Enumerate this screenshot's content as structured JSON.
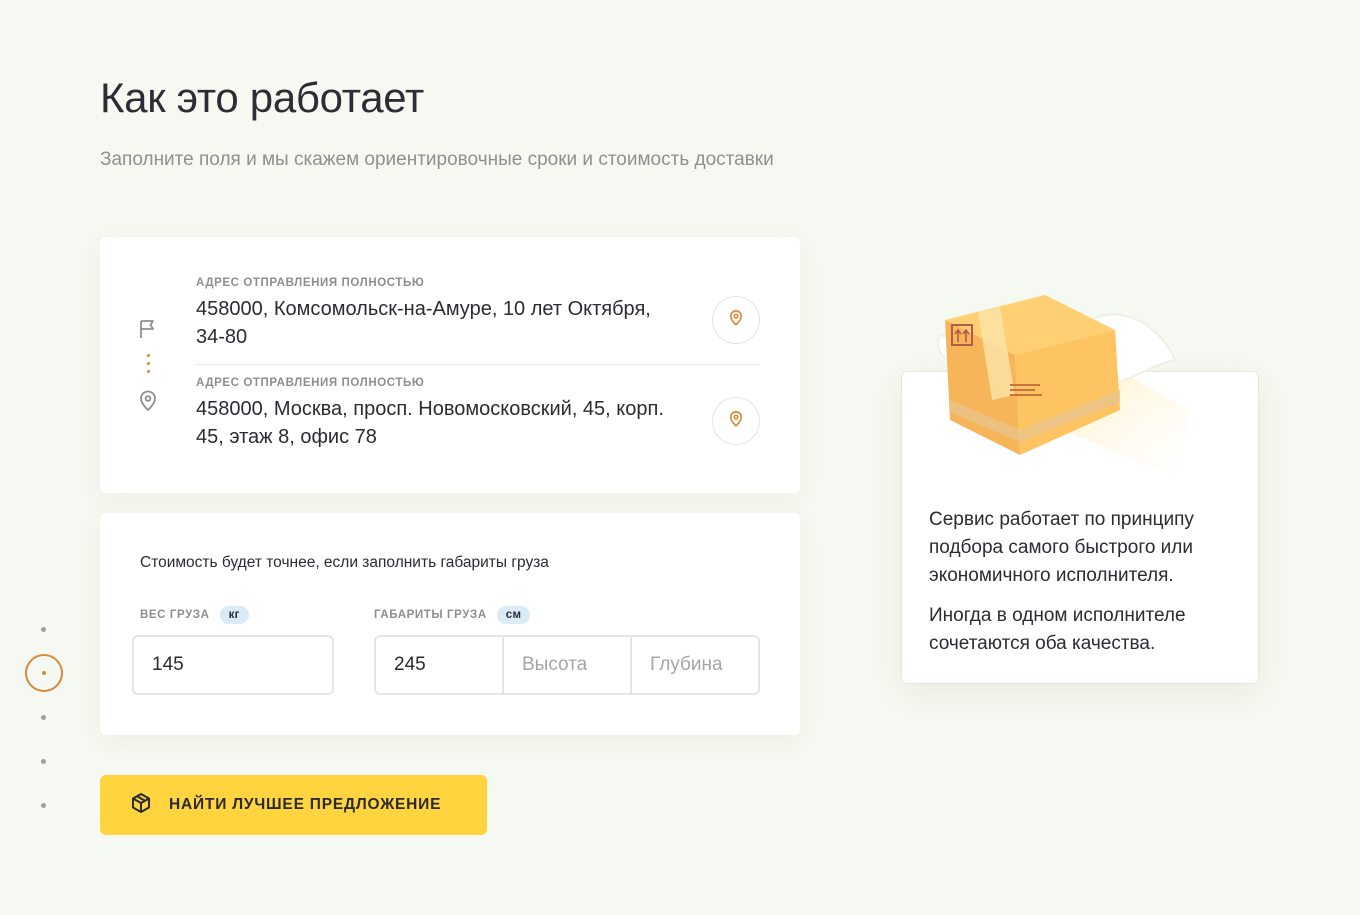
{
  "page": {
    "title": "Как это работает",
    "subtitle": "Заполните поля и мы скажем ориентировочные сроки и стоимость доставки"
  },
  "steps": {
    "count": 5,
    "active_index": 1
  },
  "address_card": {
    "from": {
      "label": "Адрес отправления полностью",
      "value": "458000, Комсомольск-на-Амуре, 10 лет Октября, 34-80",
      "icon": "flag-icon"
    },
    "to": {
      "label": "Адрес отправления полностью",
      "value": "458000, Москва, просп. Новомосковский, 45, корп. 45, этаж 8, офис 78",
      "icon": "map-pin-icon"
    },
    "map_button_icon": "map-pin-icon"
  },
  "cargo_card": {
    "hint": "Стоимость будет точнее, если заполнить габариты груза",
    "weight": {
      "label": "Вес груза",
      "unit": "кг",
      "value": "145"
    },
    "dimensions": {
      "label": "Габариты груза",
      "unit": "см",
      "length_value": "245",
      "height_placeholder": "Высота",
      "depth_placeholder": "Глубина"
    }
  },
  "cta": {
    "label": "НАЙТИ ЛУЧШЕЕ ПРЕДЛОЖЕНИЕ",
    "icon": "package-box-icon"
  },
  "info_card": {
    "paragraph1": "Сервис работает по принципу подбора самого быстрого или экономичного исполнителя.",
    "paragraph2": "Иногда в одном исполнителе сочетаются оба качества.",
    "illustration": "flying-parcel-box"
  },
  "colors": {
    "background": "#f6f9f1",
    "accent_orange": "#d88a3a",
    "cta_yellow": "#ffd43f",
    "unit_badge": "#d9ecf6"
  }
}
